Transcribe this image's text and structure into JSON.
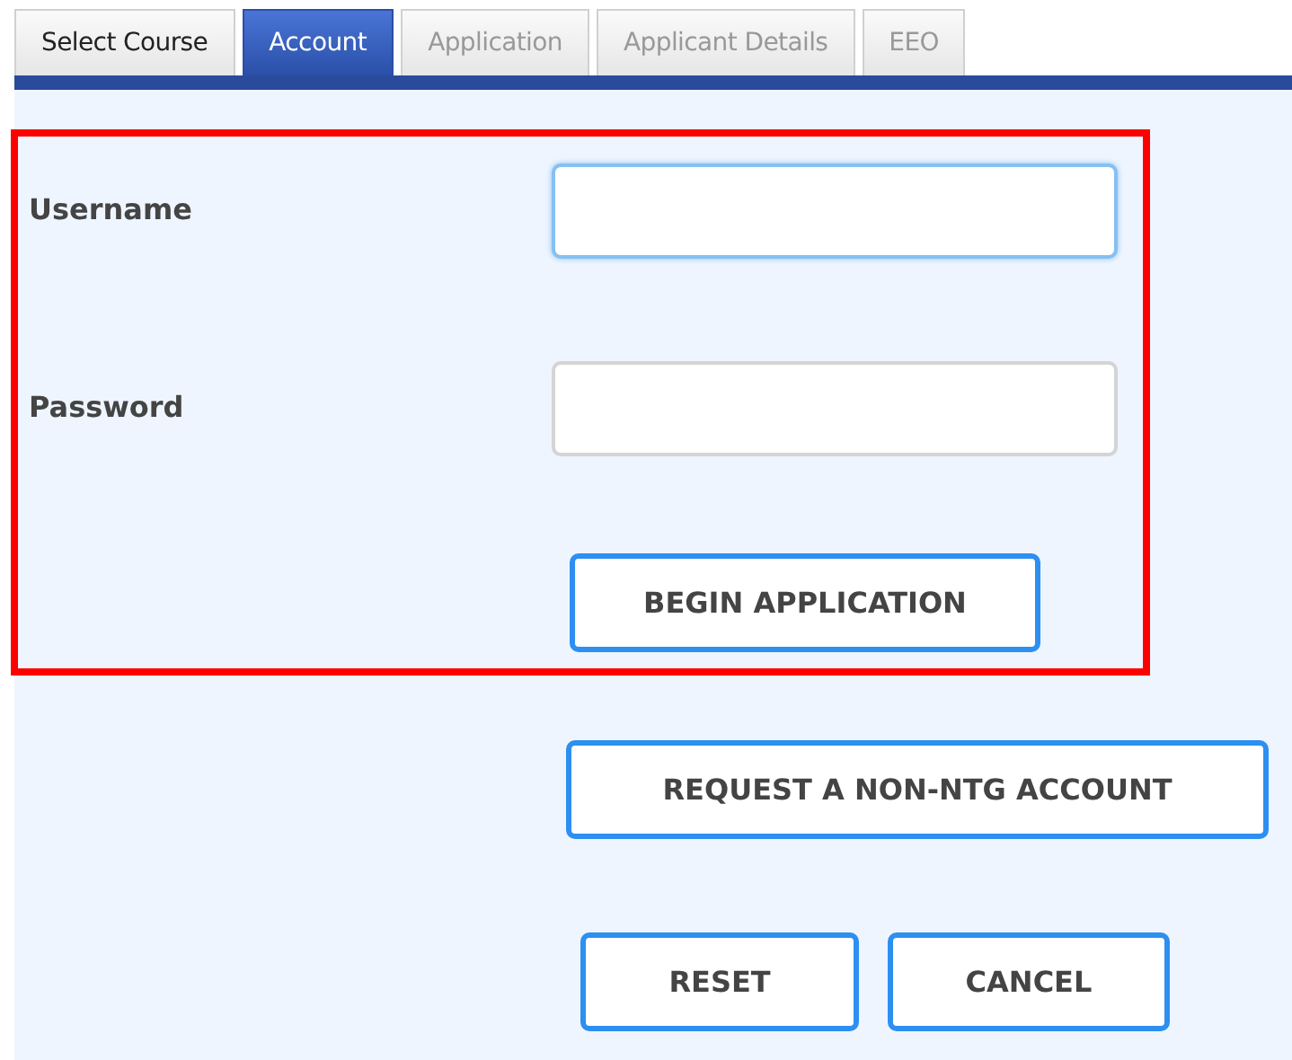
{
  "tabs": [
    {
      "label": "Select Course",
      "selected": false,
      "disabled": false
    },
    {
      "label": "Account",
      "selected": true,
      "disabled": false
    },
    {
      "label": "Application",
      "selected": false,
      "disabled": true
    },
    {
      "label": "Applicant Details",
      "selected": false,
      "disabled": true
    },
    {
      "label": "EEO",
      "selected": false,
      "disabled": true
    }
  ],
  "fields": [
    {
      "label": "Username",
      "focused": true
    },
    {
      "label": "Password",
      "focused": false
    }
  ],
  "begin_button": "BEGIN APPLICATION",
  "request_button": "REQUEST A NON-NTG ACCOUNT",
  "buttons": [
    "RESET",
    "CANCEL"
  ]
}
